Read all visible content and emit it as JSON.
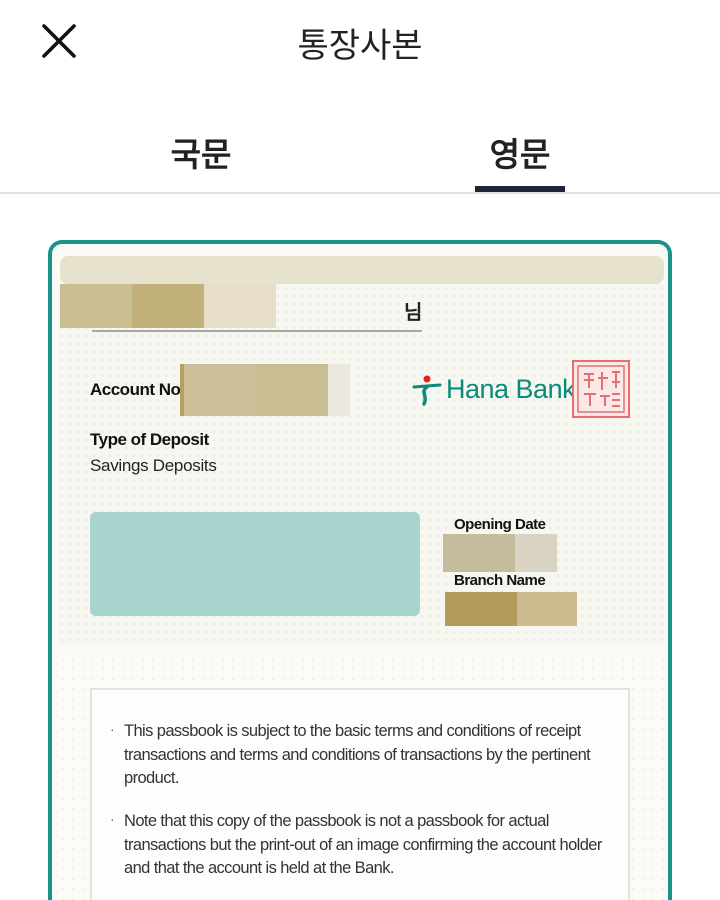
{
  "header": {
    "title": "통장사본",
    "close_icon": "close-icon"
  },
  "tabs": [
    {
      "label": "국문",
      "selected": false
    },
    {
      "label": "영문",
      "selected": true
    }
  ],
  "colors": {
    "accent": "#1a9488",
    "tab_underline": "#1f2437",
    "logo": "#0b8a7c",
    "seal": "#e46f6f"
  },
  "card": {
    "name_suffix": "님",
    "account_no_label": "Account No.",
    "type_of_deposit_label": "Type of Deposit",
    "type_of_deposit_value": "Savings Deposits",
    "bank_name": "Hana Bank",
    "opening_date_label": "Opening Date",
    "branch_name_label": "Branch Name",
    "seal_icon": "bank-seal-icon"
  },
  "notice": {
    "items": [
      "This passbook is subject to the basic terms and conditions of receipt transactions and terms and conditions of transactions by the pertinent product.",
      "Note that this copy of the passbook is not a passbook for actual transactions but the print-out of an image confirming the account holder and that the account is held at the Bank."
    ]
  }
}
